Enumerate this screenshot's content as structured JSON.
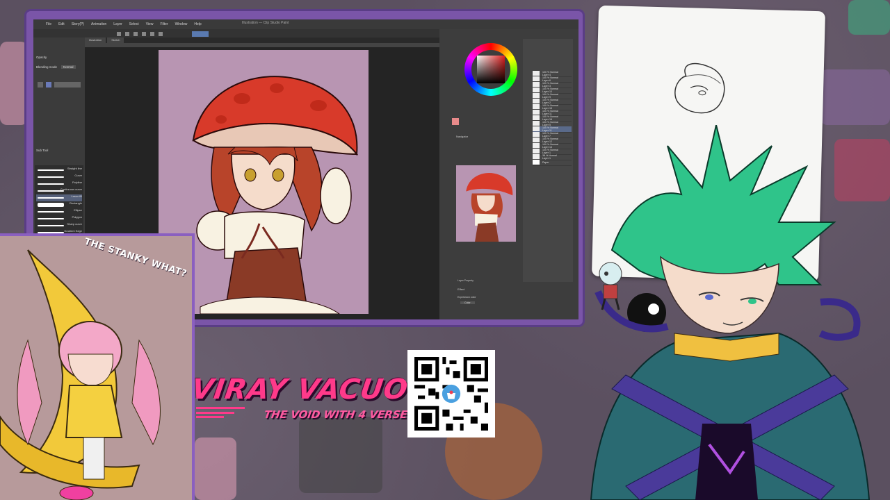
{
  "app": {
    "title": "Illustration — Clip Studio Paint",
    "menus": [
      "File",
      "Edit",
      "Story(P)",
      "Animation",
      "Layer",
      "Select",
      "View",
      "Filter",
      "Window",
      "Help"
    ],
    "canvas_tabs": [
      "Illustration",
      "Sketch"
    ],
    "left_panel": {
      "property_label": "Opacity",
      "blending_mode_label": "Blending mode",
      "blending_mode_value": "Normal",
      "tool_label": "Sub Tool",
      "brushes": [
        "Straight line",
        "Curve",
        "Polyline",
        "Continuous curve",
        "Lasso fill",
        "Rectangle",
        "Ellipse",
        "Polygon",
        "Sharp curve",
        "Gradient Edge"
      ]
    },
    "layers": [
      {
        "mode": "100 % Normal",
        "name": "Layer 4"
      },
      {
        "mode": "100 % Normal",
        "name": "Layer 6"
      },
      {
        "mode": "100 % Normal",
        "name": "Layer 3"
      },
      {
        "mode": "100 % Normal",
        "name": "Layer 10"
      },
      {
        "mode": "100 % Normal",
        "name": "Layer 9"
      },
      {
        "mode": "100 % Normal",
        "name": "Layer 2"
      },
      {
        "mode": "100 % Normal",
        "name": "Layer 15"
      },
      {
        "mode": "100 % Normal",
        "name": "Layer 11"
      },
      {
        "mode": "100 % Normal",
        "name": "Layer 16"
      },
      {
        "mode": "100 % Normal",
        "name": "Layer 5"
      },
      {
        "mode": "100 % Normal",
        "name": "Layer 11"
      },
      {
        "mode": "100 % Normal",
        "name": "Layer 7"
      },
      {
        "mode": "100 % Normal",
        "name": "Layer 12"
      },
      {
        "mode": "100 % Normal",
        "name": "Layer 14"
      },
      {
        "mode": "100 % Normal",
        "name": "Layer 1"
      },
      {
        "mode": "38 % Normal",
        "name": "Layer 1"
      },
      {
        "mode": "",
        "name": "Paper"
      }
    ],
    "panels": {
      "navigator_label": "Navigator",
      "layer_property_label": "Layer Property",
      "effect_label": "Effect",
      "expression_color_label": "Expression color",
      "expression_color_value": "Color"
    },
    "colors": {
      "current": "#e02020"
    }
  },
  "overlay": {
    "caption": "THE STANKY WHAT?",
    "logo_main": "VIRAY VACUO",
    "logo_sub": "THE VOID WITH 4 VERSE"
  },
  "colors": {
    "frame": "#7a55a8",
    "logo": "#ff3a8a",
    "hair": "#2fc48a"
  }
}
